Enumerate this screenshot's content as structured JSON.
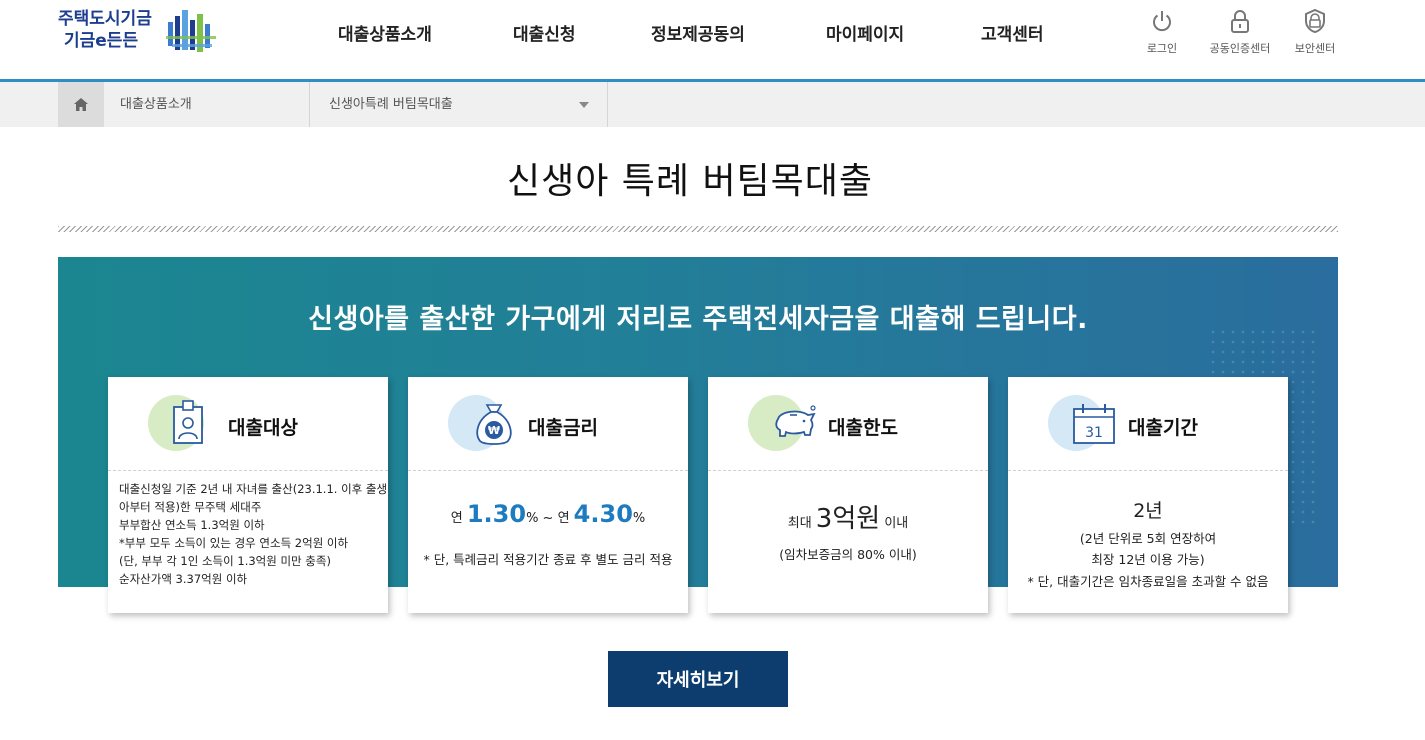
{
  "logo": {
    "line1": "주택도시기금",
    "line2": "기금e든든"
  },
  "gnb": [
    {
      "label": "대출상품소개"
    },
    {
      "label": "대출신청"
    },
    {
      "label": "정보제공동의"
    },
    {
      "label": "마이페이지"
    },
    {
      "label": "고객센터"
    }
  ],
  "util": [
    {
      "label": "로그인",
      "icon": "power-icon"
    },
    {
      "label": "공동인증센터",
      "icon": "lock-icon"
    },
    {
      "label": "보안센터",
      "icon": "shield-icon"
    }
  ],
  "breadcrumb": {
    "level1": "대출상품소개",
    "level2": "신생아특례 버팀목대출"
  },
  "page_title": "신생아 특례 버팀목대출",
  "banner_title": "신생아를 출산한 가구에게 저리로 주택전세자금을 대출해 드립니다.",
  "cards": {
    "target": {
      "title": "대출대상",
      "lines": [
        "대출신청일 기준 2년 내 자녀를 출산(23.1.1. 이후 출생",
        "아부터 적용)한 무주택 세대주",
        "부부합산 연소득 1.3억원 이하",
        "*부부 모두 소득이 있는 경우 연소득 2억원 이하",
        "(단, 부부 각 1인 소득이 1.3억원 미만 충족)",
        "순자산가액 3.37억원 이하"
      ]
    },
    "rate": {
      "title": "대출금리",
      "prefix1": "연 ",
      "min": "1.30",
      "unit1": "% ~ 연 ",
      "max": "4.30",
      "unit2": "%",
      "note": "* 단, 특례금리 적용기간 종료 후 별도 금리 적용"
    },
    "limit": {
      "title": "대출한도",
      "prefix": "최대 ",
      "amount": "3억원",
      "suffix": " 이내",
      "note": "(임차보증금의 80% 이내)"
    },
    "period": {
      "title": "대출기간",
      "calendar_day": "31",
      "main": "2년",
      "line1": "(2년 단위로 5회 연장하여",
      "line2": "최장 12년 이용 가능)",
      "line3": "* 단, 대출기간은 임차종료일을 초과할 수 없음"
    }
  },
  "more_button": "자세히보기",
  "colors": {
    "brand_navy": "#1d3e8f",
    "header_line": "#2d8ec4",
    "banner_teal": "#1b8690",
    "rate_blue": "#1e7bc0",
    "button_navy": "#0c3d6e",
    "icon_green_bg": "#d7ecc4",
    "icon_blue_bg": "#d4e8f6"
  }
}
